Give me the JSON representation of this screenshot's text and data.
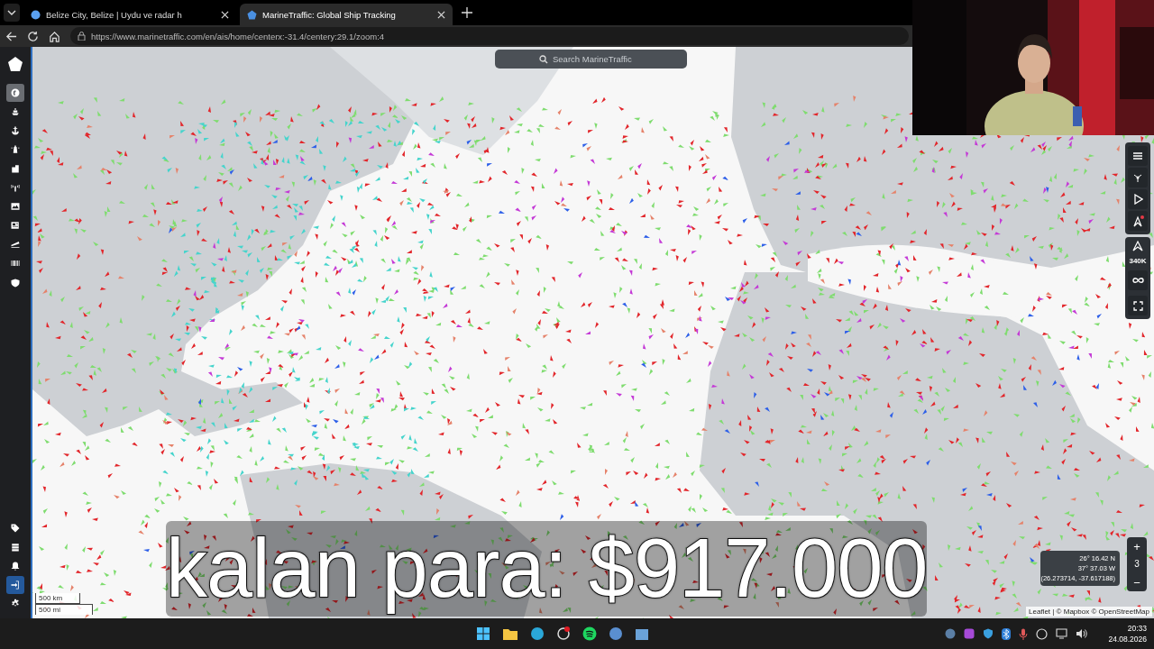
{
  "browser": {
    "tabs": [
      {
        "title": "Belize City, Belize | Uydu ve radar h",
        "selected": false
      },
      {
        "title": "MarineTraffic: Global Ship Tracking",
        "selected": true
      }
    ],
    "url": "https://www.marinetraffic.com/en/ais/home/centerx:-31.4/centery:29.1/zoom:4"
  },
  "sidebar": {
    "items": [
      {
        "selected": true
      },
      {
        "selected": false
      },
      {
        "selected": false
      },
      {
        "selected": false
      },
      {
        "selected": false
      },
      {
        "selected": false
      },
      {
        "selected": false
      },
      {
        "selected": false
      },
      {
        "selected": false
      },
      {
        "selected": false
      }
    ],
    "bottom_items": [
      {
        "selected": false
      },
      {
        "selected": false
      },
      {
        "selected": false
      },
      {
        "selected": true
      },
      {
        "selected": false
      }
    ]
  },
  "map": {
    "search": {
      "placeholder": "Search MarineTraffic"
    },
    "vessel_count": "340K",
    "zoom_in": "+",
    "zoom_level": "3",
    "zoom_out": "−",
    "coordinates": [
      "26° 16.42 N",
      "37° 37.03 W",
      "(26.273714, -37.617188)"
    ],
    "scale": [
      "500 km",
      "500 mi"
    ],
    "attribution": "Leaflet | © Mapbox © OpenStreetMap"
  },
  "caption": "kalan para: $917.000",
  "taskbar": {
    "time": "20:33",
    "date": "24.08.2026"
  }
}
